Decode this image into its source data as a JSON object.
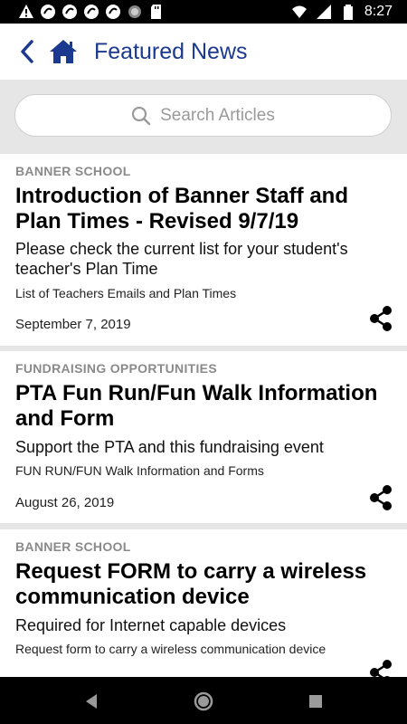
{
  "status_bar": {
    "time": "8:27",
    "icons": [
      "alert-icon",
      "sync-icon",
      "sync-icon",
      "sync-icon",
      "sync-icon",
      "circle-dot-icon",
      "sd-card-icon",
      "wifi-icon",
      "signal-icon",
      "battery-icon"
    ]
  },
  "header": {
    "title": "Featured News",
    "back_icon": "back-icon",
    "home_icon": "home-icon",
    "accent": "#1b3a8f"
  },
  "search": {
    "placeholder": "Search Articles"
  },
  "articles": [
    {
      "category": "BANNER SCHOOL",
      "title": "Introduction of Banner Staff and Plan Times - Revised 9/7/19",
      "subtitle": "Please check the current list for your student's teacher's Plan Time",
      "description": "List of Teachers Emails and Plan Times",
      "date": "September 7, 2019"
    },
    {
      "category": "FUNDRAISING OPPORTUNITIES",
      "title": "PTA Fun Run/Fun Walk Information and Form",
      "subtitle": "Support the PTA and this fundraising event",
      "description": "FUN RUN/FUN Walk Information and Forms",
      "date": "August 26, 2019"
    },
    {
      "category": "BANNER SCHOOL",
      "title": "Request FORM to carry a wireless communication device",
      "subtitle": "Required for Internet capable devices",
      "description": "Request form to carry a wireless communication device",
      "date": ""
    }
  ],
  "nav_bar": {
    "icons": [
      "back-triangle-icon",
      "home-circle-icon",
      "recents-square-icon"
    ]
  }
}
